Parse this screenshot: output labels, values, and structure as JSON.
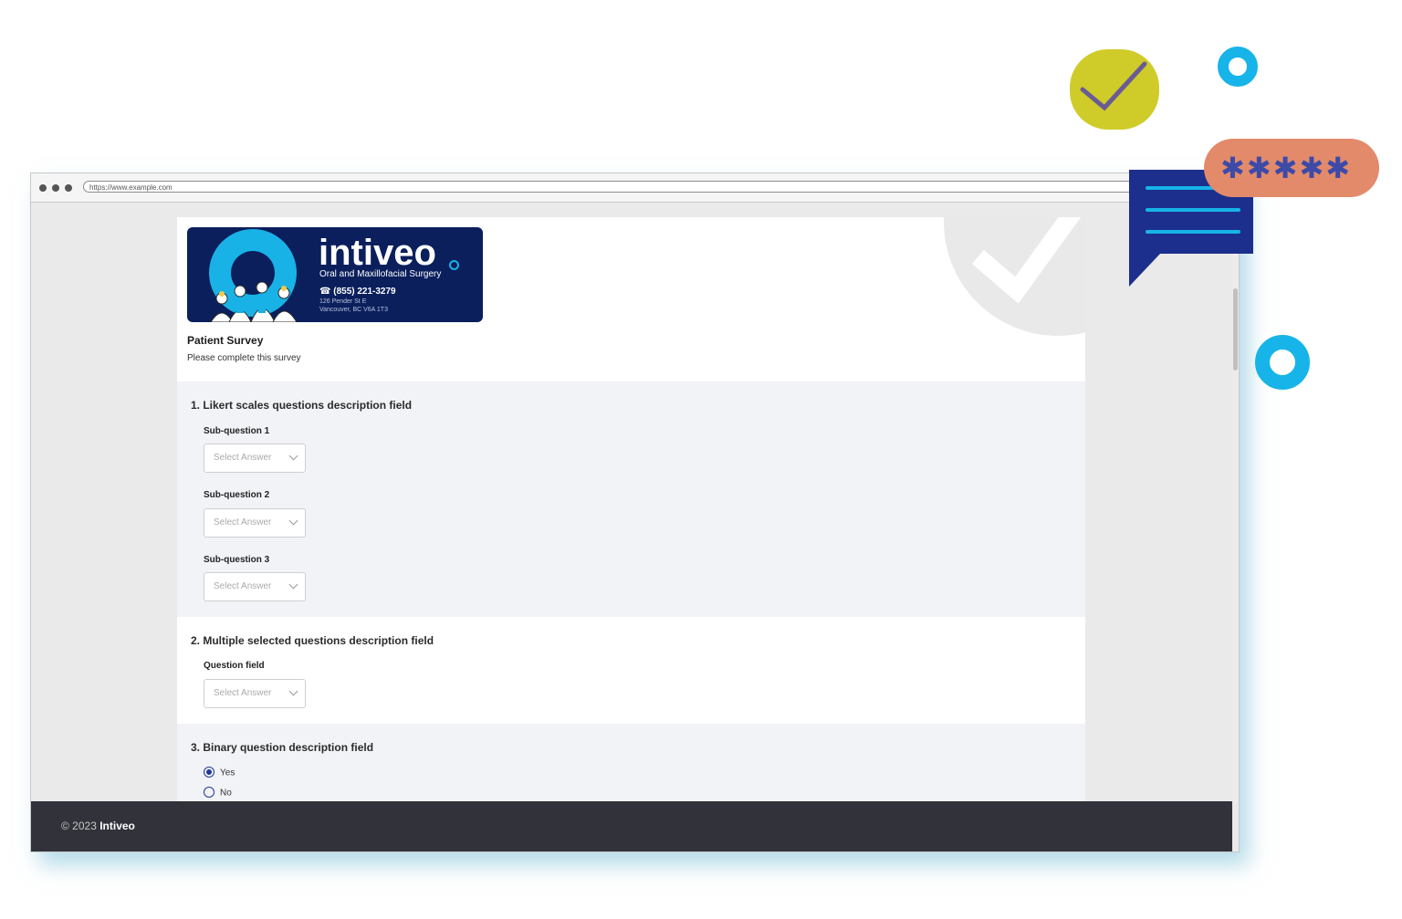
{
  "browser": {
    "url": "https://www.example.com"
  },
  "logo": {
    "brand": "intiveo",
    "tagline": "Oral and Maxillofacial Surgery",
    "phone": "☎ (855) 221-3279",
    "address_line1": "126 Pender St E",
    "address_line2": "Vancouver, BC V6A 1T3"
  },
  "survey": {
    "title": "Patient Survey",
    "subtitle": "Please complete this survey"
  },
  "questions": {
    "q1": {
      "title": "1. Likert scales questions description field",
      "subs": [
        {
          "label": "Sub-question 1",
          "placeholder": "Select Answer"
        },
        {
          "label": "Sub-question 2",
          "placeholder": "Select Answer"
        },
        {
          "label": "Sub-question 3",
          "placeholder": "Select Answer"
        }
      ]
    },
    "q2": {
      "title": "2. Multiple selected questions description field",
      "label": "Question field",
      "placeholder": "Select Answer"
    },
    "q3": {
      "title": "3. Binary question description field",
      "options": [
        {
          "label": "Yes",
          "checked": true
        },
        {
          "label": "No",
          "checked": false
        }
      ]
    }
  },
  "footer": {
    "copyright": "© 2023",
    "brand": "Intiveo"
  },
  "decorations": {
    "stars": "✱✱✱✱✱",
    "colors": {
      "lime": "#cfcc2a",
      "cyan": "#16b4e8",
      "navy": "#1d2f8c",
      "salmon": "#e38a6a",
      "check_purple": "#6b5b95"
    }
  }
}
